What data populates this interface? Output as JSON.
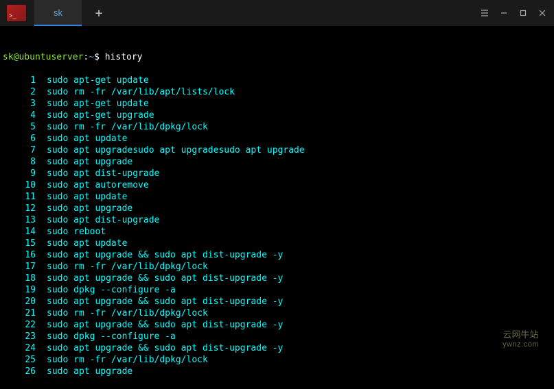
{
  "titlebar": {
    "tab_label": "sk",
    "new_tab_symbol": "+"
  },
  "prompt": {
    "user_host": "sk@ubuntuserver",
    "colon": ":",
    "path": "~",
    "dollar": "$",
    "command": "history"
  },
  "history": [
    {
      "n": "1",
      "cmd": "sudo apt-get update"
    },
    {
      "n": "2",
      "cmd": "sudo rm -fr /var/lib/apt/lists/lock"
    },
    {
      "n": "3",
      "cmd": "sudo apt-get update"
    },
    {
      "n": "4",
      "cmd": "sudo apt-get upgrade"
    },
    {
      "n": "5",
      "cmd": "sudo rm -fr /var/lib/dpkg/lock"
    },
    {
      "n": "6",
      "cmd": "sudo apt update"
    },
    {
      "n": "7",
      "cmd": "sudo apt upgradesudo apt upgradesudo apt upgrade"
    },
    {
      "n": "8",
      "cmd": "sudo apt upgrade"
    },
    {
      "n": "9",
      "cmd": "sudo apt dist-upgrade"
    },
    {
      "n": "10",
      "cmd": "sudo apt autoremove"
    },
    {
      "n": "11",
      "cmd": "sudo apt update"
    },
    {
      "n": "12",
      "cmd": "sudo apt upgrade"
    },
    {
      "n": "13",
      "cmd": "sudo apt dist-upgrade"
    },
    {
      "n": "14",
      "cmd": "sudo reboot"
    },
    {
      "n": "15",
      "cmd": "sudo apt update"
    },
    {
      "n": "16",
      "cmd": "sudo apt upgrade && sudo apt dist-upgrade -y"
    },
    {
      "n": "17",
      "cmd": "sudo rm -fr /var/lib/dpkg/lock"
    },
    {
      "n": "18",
      "cmd": "sudo apt upgrade && sudo apt dist-upgrade -y"
    },
    {
      "n": "19",
      "cmd": "sudo dpkg --configure -a"
    },
    {
      "n": "20",
      "cmd": "sudo apt upgrade && sudo apt dist-upgrade -y"
    },
    {
      "n": "21",
      "cmd": "sudo rm -fr /var/lib/dpkg/lock"
    },
    {
      "n": "22",
      "cmd": "sudo apt upgrade && sudo apt dist-upgrade -y"
    },
    {
      "n": "23",
      "cmd": "sudo dpkg --configure -a"
    },
    {
      "n": "24",
      "cmd": "sudo apt upgrade && sudo apt dist-upgrade -y"
    },
    {
      "n": "25",
      "cmd": "sudo rm -fr /var/lib/dpkg/lock"
    },
    {
      "n": "26",
      "cmd": "sudo apt upgrade"
    }
  ],
  "watermark": {
    "line1": "云网牛站",
    "line2": "ywnz.com"
  }
}
